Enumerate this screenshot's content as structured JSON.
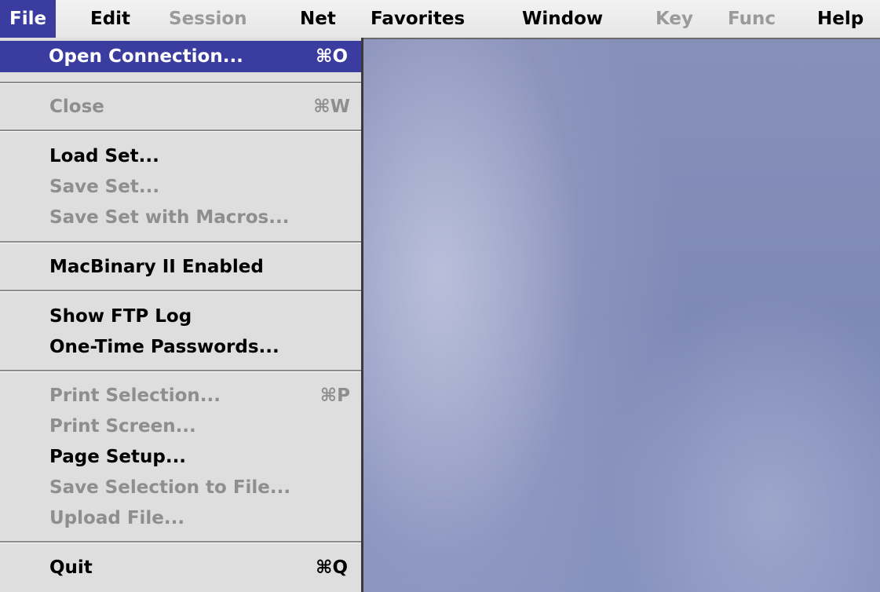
{
  "menubar": {
    "items": [
      {
        "label": "File",
        "state": "active"
      },
      {
        "label": "Edit",
        "state": "enabled"
      },
      {
        "label": "Session",
        "state": "disabled"
      },
      {
        "label": "Net",
        "state": "enabled"
      },
      {
        "label": "Favorites",
        "state": "enabled"
      },
      {
        "label": "Window",
        "state": "enabled"
      },
      {
        "label": "Key",
        "state": "disabled"
      },
      {
        "label": "Func",
        "state": "disabled"
      },
      {
        "label": "Help",
        "state": "enabled"
      }
    ]
  },
  "file_menu": {
    "items": [
      {
        "label": "Open Connection...",
        "shortcut": "⌘O",
        "state": "highlighted"
      },
      {
        "label": "Close",
        "shortcut": "⌘W",
        "state": "disabled"
      },
      {
        "label": "Load Set...",
        "shortcut": "",
        "state": "enabled"
      },
      {
        "label": "Save Set...",
        "shortcut": "",
        "state": "disabled"
      },
      {
        "label": "Save Set with Macros...",
        "shortcut": "",
        "state": "disabled"
      },
      {
        "label": "MacBinary II Enabled",
        "shortcut": "",
        "state": "enabled"
      },
      {
        "label": "Show FTP Log",
        "shortcut": "",
        "state": "enabled"
      },
      {
        "label": "One-Time Passwords...",
        "shortcut": "",
        "state": "enabled"
      },
      {
        "label": "Print Selection...",
        "shortcut": "⌘P",
        "state": "disabled"
      },
      {
        "label": "Print Screen...",
        "shortcut": "",
        "state": "disabled"
      },
      {
        "label": "Page Setup...",
        "shortcut": "",
        "state": "enabled"
      },
      {
        "label": "Save Selection to File...",
        "shortcut": "",
        "state": "disabled"
      },
      {
        "label": "Upload File...",
        "shortcut": "",
        "state": "disabled"
      },
      {
        "label": "Quit",
        "shortcut": "⌘Q",
        "state": "enabled"
      }
    ]
  },
  "colors": {
    "highlight": "#3a3ca0",
    "disabled_text": "#8e8e8e",
    "menu_background": "#dedede",
    "desktop": "#8790b9"
  }
}
